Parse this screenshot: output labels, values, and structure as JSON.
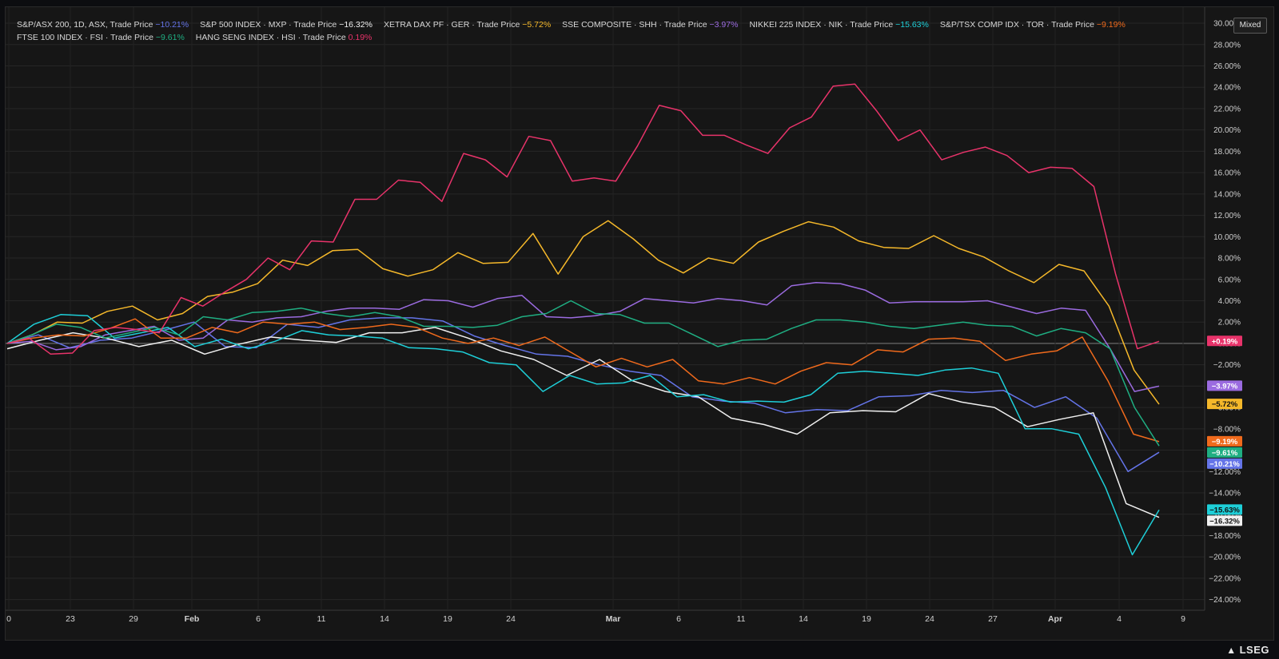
{
  "toolbar": {
    "mode_label": "Mixed"
  },
  "brand": {
    "name": "LSEG"
  },
  "chart_data": {
    "type": "line",
    "title": "",
    "xlabel": "",
    "ylabel": "",
    "ylim": [
      -25,
      31.5
    ],
    "yticks": [
      30,
      28,
      26,
      24,
      22,
      20,
      18,
      16,
      14,
      12,
      10,
      8,
      6,
      4,
      2,
      0,
      -2,
      -4,
      -6,
      -8,
      -10,
      -12,
      -14,
      -16,
      -18,
      -20,
      -22,
      -24
    ],
    "ytick_format": "percent_2dp",
    "x_axis_ticks": [
      "0",
      "23",
      "29",
      "Feb",
      "6",
      "11",
      "14",
      "19",
      "24",
      "Mar",
      "6",
      "11",
      "14",
      "19",
      "24",
      "27",
      "Apr",
      "4",
      "9"
    ],
    "legend_placement": "top-left",
    "zero_line": true,
    "grid": true,
    "colors": {
      "hang_seng": "#e8336a",
      "dax": "#f5b82a",
      "sse": "#9b6be0",
      "ftse": "#1fae82",
      "tsx": "#f06a1c",
      "asx": "#6474e8",
      "nikkei": "#1ecfd8",
      "sp500": "#f0f0f0"
    },
    "series": [
      {
        "key": "asx",
        "name": "S&P/ASX 200, 1D, ASX, Trade Price",
        "change": "−10.21%",
        "end_label": "−10.21%",
        "color": "#6474e8",
        "values": [
          0,
          0.8,
          -0.4,
          0.3,
          0.5,
          1.2,
          2.0,
          -0.3,
          -0.4,
          1.8,
          1.5,
          2.2,
          2.4,
          2.4,
          2.1,
          0.7,
          -0.2,
          -1.0,
          -1.2,
          -2.0,
          -2.6,
          -3.0,
          -5.0,
          -5.4,
          -5.6,
          -6.5,
          -6.2,
          -6.3,
          -5.0,
          -4.9,
          -4.4,
          -4.6,
          -4.4,
          -6.0,
          -5.0,
          -7.0,
          -12.0,
          -10.2
        ]
      },
      {
        "key": "sp500",
        "name": "S&P 500 INDEX · MXP · Trade Price",
        "change": "−16.32%",
        "end_label": "−16.32%",
        "color": "#f0f0f0",
        "values": [
          -0.5,
          0.3,
          1.0,
          0.5,
          -0.3,
          0.3,
          -1.0,
          -0.1,
          0.6,
          0.3,
          0.1,
          1.0,
          1.0,
          1.5,
          0.5,
          -0.7,
          -1.5,
          -3.0,
          -1.5,
          -3.5,
          -4.5,
          -5.0,
          -7.0,
          -7.6,
          -8.5,
          -6.5,
          -6.3,
          -6.4,
          -4.7,
          -5.5,
          -6.0,
          -7.8,
          -7.1,
          -6.5,
          -15.0,
          -16.3
        ]
      },
      {
        "key": "dax",
        "name": "XETRA DAX PF · GER · Trade Price",
        "change": "−5.72%",
        "end_label": "−5.72%",
        "color": "#f5b82a",
        "values": [
          0,
          0.8,
          2.0,
          1.9,
          3.0,
          3.5,
          2.2,
          2.8,
          4.4,
          4.8,
          5.6,
          7.8,
          7.3,
          8.7,
          8.8,
          7.0,
          6.3,
          6.9,
          8.5,
          7.5,
          7.6,
          10.3,
          6.5,
          10.0,
          11.5,
          9.8,
          7.8,
          6.6,
          8.0,
          7.5,
          9.5,
          10.5,
          11.4,
          10.9,
          9.6,
          9.0,
          8.9,
          10.1,
          8.9,
          8.1,
          6.8,
          5.7,
          7.4,
          6.8,
          3.5,
          -2.5,
          -5.7
        ]
      },
      {
        "key": "sse",
        "name": "SSE COMPOSITE · SHH · Trade Price",
        "change": "−3.97%",
        "end_label": "−3.97%",
        "color": "#9b6be0",
        "values": [
          0,
          0.2,
          -0.6,
          -0.3,
          0.8,
          1.2,
          1.6,
          0.3,
          0.5,
          2.2,
          2.0,
          2.4,
          2.5,
          3.0,
          3.3,
          3.3,
          3.2,
          4.1,
          4.0,
          3.4,
          4.2,
          4.5,
          2.5,
          2.4,
          2.6,
          3.0,
          4.2,
          4.0,
          3.8,
          4.2,
          4.0,
          3.6,
          5.4,
          5.7,
          5.6,
          5.0,
          3.8,
          3.9,
          3.9,
          3.9,
          4.0,
          3.4,
          2.8,
          3.3,
          3.1,
          -0.5,
          -4.5,
          -4.0
        ]
      },
      {
        "key": "nikkei",
        "name": "NIKKEI 225 INDEX · NIK · Trade Price",
        "change": "−15.63%",
        "end_label": "−15.63%",
        "color": "#1ecfd8",
        "values": [
          0,
          1.8,
          2.7,
          2.6,
          0.5,
          1.0,
          1.5,
          -0.3,
          0.4,
          -0.5,
          0.2,
          1.2,
          0.8,
          0.7,
          0.5,
          -0.4,
          -0.5,
          -0.8,
          -1.8,
          -2.0,
          -4.5,
          -3.0,
          -3.8,
          -3.7,
          -3.0,
          -5.0,
          -4.8,
          -5.5,
          -5.4,
          -5.5,
          -4.8,
          -2.8,
          -2.6,
          -2.8,
          -3.0,
          -2.5,
          -2.3,
          -2.8,
          -8.0,
          -8.0,
          -8.5,
          -13.5,
          -19.8,
          -15.6
        ]
      },
      {
        "key": "tsx",
        "name": "S&P/TSX COMP IDX · TOR · Trade Price",
        "change": "−9.19%",
        "end_label": "−9.19%",
        "color": "#f06a1c",
        "values": [
          0,
          0.5,
          0.8,
          0.7,
          1.4,
          2.3,
          0.5,
          0.5,
          1.5,
          1.0,
          2.0,
          1.8,
          2.0,
          1.3,
          1.5,
          1.8,
          1.5,
          0.5,
          0,
          0.5,
          -0.2,
          0.6,
          -0.8,
          -2.2,
          -1.4,
          -2.2,
          -1.5,
          -3.5,
          -3.8,
          -3.2,
          -3.8,
          -2.6,
          -1.8,
          -2.0,
          -0.6,
          -0.8,
          0.4,
          0.5,
          0.2,
          -1.6,
          -1.0,
          -0.7,
          0.6,
          -3.5,
          -8.5,
          -9.2
        ]
      },
      {
        "key": "ftse",
        "name": "FTSE 100 INDEX · FSI · Trade Price",
        "change": "−9.61%",
        "end_label": "−9.61%",
        "color": "#1fae82",
        "values": [
          0,
          0.8,
          1.8,
          1.5,
          0.5,
          1.0,
          1.5,
          0.8,
          2.5,
          2.2,
          2.9,
          3.0,
          3.3,
          2.8,
          2.5,
          2.9,
          2.5,
          1.6,
          1.6,
          1.5,
          1.7,
          2.5,
          2.8,
          4.0,
          2.8,
          2.7,
          1.9,
          1.9,
          0.8,
          -0.3,
          0.3,
          0.4,
          1.4,
          2.2,
          2.2,
          2.0,
          1.6,
          1.4,
          1.7,
          2.0,
          1.7,
          1.6,
          0.7,
          1.4,
          1.0,
          -0.5,
          -6.0,
          -9.6
        ]
      },
      {
        "key": "hang_seng",
        "name": "HANG SENG INDEX · HSI · Trade Price",
        "change": "0.19%",
        "end_label": "+0.19%",
        "color": "#e8336a",
        "values": [
          0,
          0.5,
          -1.0,
          -0.9,
          1.2,
          1.5,
          1.3,
          1.0,
          4.3,
          3.5,
          4.8,
          6.0,
          8.0,
          6.9,
          9.6,
          9.5,
          13.5,
          13.5,
          15.3,
          15.1,
          13.3,
          17.8,
          17.2,
          15.6,
          19.4,
          19.0,
          15.2,
          15.5,
          15.2,
          18.5,
          22.3,
          21.8,
          19.5,
          19.5,
          18.6,
          17.8,
          20.2,
          21.2,
          24.1,
          24.3,
          21.8,
          19.0,
          20.0,
          17.2,
          17.9,
          18.4,
          17.6,
          16.0,
          16.5,
          16.4,
          14.7,
          6.5,
          -0.5,
          0.2
        ]
      }
    ]
  }
}
